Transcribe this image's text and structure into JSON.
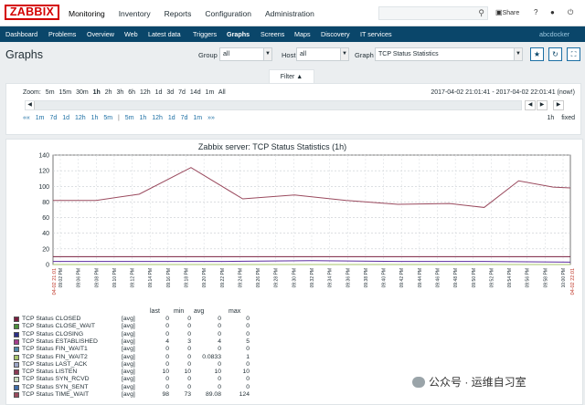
{
  "header": {
    "logo": "ZABBIX",
    "nav": [
      "Monitoring",
      "Inventory",
      "Reports",
      "Configuration",
      "Administration"
    ],
    "share_label": "Share",
    "help": "?",
    "search_placeholder": ""
  },
  "subnav": {
    "items": [
      "Dashboard",
      "Problems",
      "Overview",
      "Web",
      "Latest data",
      "Triggers",
      "Graphs",
      "Screens",
      "Maps",
      "Discovery",
      "IT services"
    ],
    "active": "Graphs",
    "user": "abcdocker"
  },
  "page": {
    "title": "Graphs",
    "group_label": "Group",
    "group_value": "all",
    "host_label": "Host",
    "host_value": "all",
    "graph_label": "Graph",
    "graph_value": "TCP Status Statistics"
  },
  "filter": {
    "tab_label": "Filter ▲",
    "zoom_label": "Zoom:",
    "zoom_options": [
      "5m",
      "15m",
      "30m",
      "1h",
      "2h",
      "3h",
      "6h",
      "12h",
      "1d",
      "3d",
      "7d",
      "14d",
      "1m",
      "All"
    ],
    "zoom_active": "1h",
    "period": "2017-04-02 21:01:41 - 2017-04-02 22:01:41 (now!)",
    "back_label": "««",
    "back_steps": [
      "1m",
      "7d",
      "1d",
      "12h",
      "1h",
      "5m"
    ],
    "fwd_steps": [
      "5m",
      "1h",
      "12h",
      "1d",
      "7d",
      "1m"
    ],
    "fwd_label": "»»",
    "sep": "|",
    "span_label": "1h",
    "fixed_label": "fixed"
  },
  "chart_data": {
    "type": "line",
    "title": "Zabbix server: TCP Status Statistics (1h)",
    "ylim": [
      0,
      140
    ],
    "yticks": [
      0,
      20,
      40,
      60,
      80,
      100,
      120,
      140
    ],
    "x_start_label": "04-02 21:01",
    "x_end_label": "04-02 22:01",
    "xticks": [
      "09:02 PM",
      "09:06 PM",
      "09:08 PM",
      "09:10 PM",
      "09:12 PM",
      "09:14 PM",
      "09:16 PM",
      "09:18 PM",
      "09:20 PM",
      "09:22 PM",
      "09:24 PM",
      "09:26 PM",
      "09:28 PM",
      "09:30 PM",
      "09:32 PM",
      "09:34 PM",
      "09:36 PM",
      "09:38 PM",
      "09:40 PM",
      "09:42 PM",
      "09:44 PM",
      "09:46 PM",
      "09:48 PM",
      "09:50 PM",
      "09:52 PM",
      "09:54 PM",
      "09:56 PM",
      "09:58 PM",
      "10:00 PM"
    ],
    "x_minutes": [
      0,
      60
    ],
    "series": [
      {
        "name": "TCP Status TIME_WAIT",
        "color": "#9a4a5e",
        "x": [
          0,
          5,
          10,
          16,
          22,
          28,
          34,
          40,
          46,
          50,
          54,
          58,
          60
        ],
        "values": [
          82,
          82,
          90,
          124,
          84,
          89,
          82,
          77,
          78,
          73,
          107,
          99,
          98
        ]
      },
      {
        "name": "TCP Status LISTEN",
        "color": "#7a1f3f",
        "x": [
          0,
          60
        ],
        "values": [
          10,
          10
        ]
      },
      {
        "name": "TCP Status ESTABLISHED",
        "color": "#5c2da0",
        "x": [
          0,
          10,
          20,
          30,
          40,
          50,
          60
        ],
        "values": [
          4,
          4,
          4,
          5,
          4,
          4,
          3
        ]
      },
      {
        "name": "TCP Status FIN_WAIT2",
        "color": "#a7c56b",
        "x": [
          0,
          60
        ],
        "values": [
          0,
          0
        ]
      }
    ],
    "legend_headers": [
      "last",
      "min",
      "avg",
      "max"
    ],
    "legend": [
      {
        "name": "TCP Status CLOSED",
        "color": "#7a1f3f",
        "fn": "[avg]",
        "last": "0",
        "min": "0",
        "avg": "0",
        "max": "0"
      },
      {
        "name": "TCP Status CLOSE_WAIT",
        "color": "#4b8f3a",
        "fn": "[avg]",
        "last": "0",
        "min": "0",
        "avg": "0",
        "max": "0"
      },
      {
        "name": "TCP Status CLOSING",
        "color": "#2c2f87",
        "fn": "[avg]",
        "last": "0",
        "min": "0",
        "avg": "0",
        "max": "0"
      },
      {
        "name": "TCP Status ESTABLISHED",
        "color": "#a43d8c",
        "fn": "[avg]",
        "last": "4",
        "min": "3",
        "avg": "4",
        "max": "5"
      },
      {
        "name": "TCP Status FIN_WAIT1",
        "color": "#4f87a9",
        "fn": "[avg]",
        "last": "0",
        "min": "0",
        "avg": "0",
        "max": "0"
      },
      {
        "name": "TCP Status FIN_WAIT2",
        "color": "#a7c56b",
        "fn": "[avg]",
        "last": "0",
        "min": "0",
        "avg": "0.0833",
        "max": "1"
      },
      {
        "name": "TCP Status LAST_ACK",
        "color": "#9ea7c8",
        "fn": "[avg]",
        "last": "0",
        "min": "0",
        "avg": "0",
        "max": "0"
      },
      {
        "name": "TCP Status LISTEN",
        "color": "#8c3a55",
        "fn": "[avg]",
        "last": "10",
        "min": "10",
        "avg": "10",
        "max": "10"
      },
      {
        "name": "TCP Status SYN_RCVD",
        "color": "#c7dcc0",
        "fn": "[avg]",
        "last": "0",
        "min": "0",
        "avg": "0",
        "max": "0"
      },
      {
        "name": "TCP Status SYN_SENT",
        "color": "#3f6ca8",
        "fn": "[avg]",
        "last": "0",
        "min": "0",
        "avg": "0",
        "max": "0"
      },
      {
        "name": "TCP Status TIME_WAIT",
        "color": "#9a4a5e",
        "fn": "[avg]",
        "last": "98",
        "min": "73",
        "avg": "89.08",
        "max": "124"
      }
    ]
  },
  "watermark": "公众号 · 运维自习室"
}
